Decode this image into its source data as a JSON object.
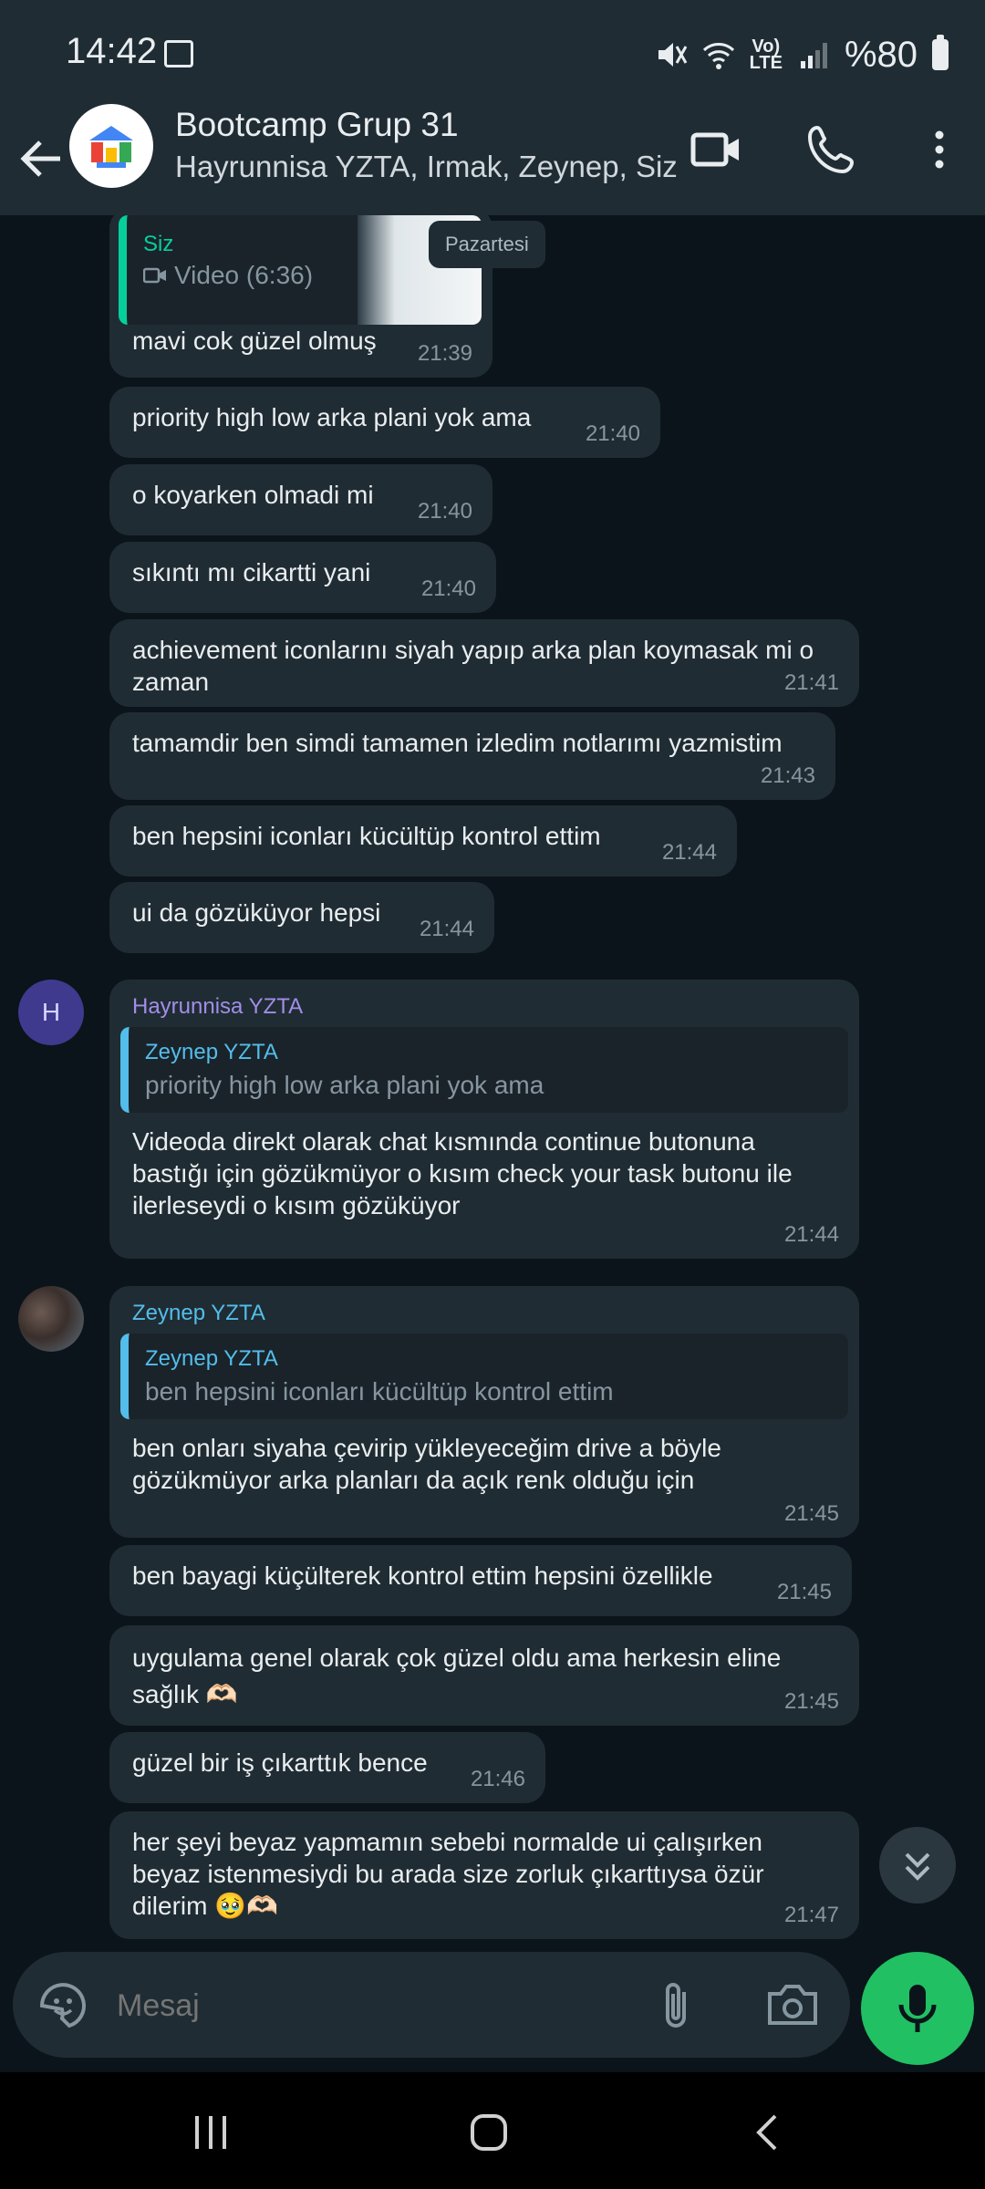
{
  "status_bar": {
    "time": "14:42",
    "battery": "%80"
  },
  "header": {
    "title": "Bootcamp Grup 31",
    "subtitle": "Hayrunnisa YZTA, Irmak, Zeynep, Siz"
  },
  "date_chip": "Pazartesi",
  "top_message": {
    "quote_sender": "Siz",
    "quote_text": "Video (6:36)",
    "text": "mavi cok güzel olmuş",
    "time": "21:39"
  },
  "messages": [
    {
      "text": "priority high low arka plani yok ama",
      "time": "21:40"
    },
    {
      "text": "o koyarken olmadi mi",
      "time": "21:40"
    },
    {
      "text": "sıkıntı mı cikartti yani",
      "time": "21:40"
    },
    {
      "text": "achievement iconlarını siyah yapıp arka plan koymasak mi o zaman",
      "time": "21:41"
    },
    {
      "text": "tamamdir ben simdi tamamen izledim notlarımı yazmistim",
      "time": "21:43"
    },
    {
      "text": "ben hepsini iconları kücültüp kontrol ettim",
      "time": "21:44"
    },
    {
      "text": "ui da gözüküyor hepsi",
      "time": "21:44"
    }
  ],
  "hayrunnisa": {
    "avatar_letter": "H",
    "sender": "Hayrunnisa YZTA",
    "quote_sender": "Zeynep YZTA",
    "quote_text": "priority high low arka plani yok ama",
    "text": "Videoda direkt olarak chat kısmında continue butonuna bastığı için gözükmüyor o kısım check your task butonu ile ilerleseydi o kısım gözüküyor",
    "time": "21:44"
  },
  "zeynep": {
    "sender": "Zeynep YZTA",
    "quote_sender": "Zeynep YZTA",
    "quote_text": "ben hepsini iconları kücültüp kontrol ettim",
    "text": "ben onları siyaha çevirip yükleyeceğim drive a böyle gözükmüyor arka planları da açık renk olduğu için",
    "time": "21:45"
  },
  "messages2": [
    {
      "text": "ben bayagi küçülterek kontrol ettim hepsini özellikle",
      "time": "21:45"
    },
    {
      "text": "uygulama genel olarak çok güzel oldu ama herkesin eline sağlık 🫶🏻",
      "time": "21:45"
    },
    {
      "text": "güzel bir iş çıkarttık bence",
      "time": "21:46"
    },
    {
      "text": "her şeyi beyaz yapmamın sebebi normalde ui çalışırken beyaz istenmesiydi bu arada size zorluk çıkarttıysa özür dilerim 🥹🫶🏻",
      "time": "21:47"
    }
  ],
  "composer": {
    "placeholder": "Mesaj"
  },
  "colors": {
    "accent_green": "#21c063",
    "bubble": "#202c33",
    "header": "#1f2c34"
  }
}
